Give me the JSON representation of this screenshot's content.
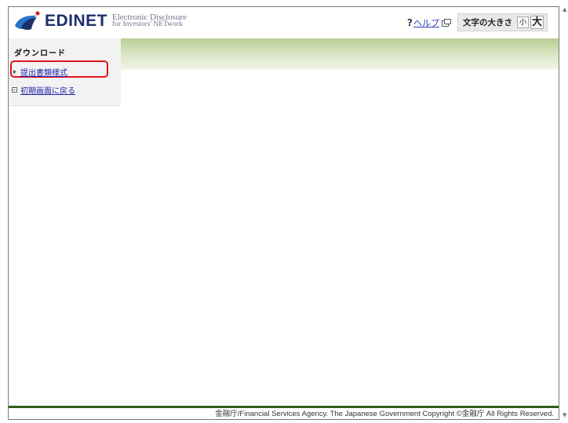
{
  "header": {
    "logo_word": "EDINET",
    "logo_sub_line1": "Electronic Disclosure",
    "logo_sub_line2": "for Investors' NETwork",
    "help_question": "?",
    "help_label": "ヘルプ",
    "font_size_label": "文字の大きさ",
    "font_small_label": "小",
    "font_large_label": "大"
  },
  "sidebar": {
    "title": "ダウンロード",
    "items": [
      {
        "label": "提出書類様式",
        "highlighted": true
      },
      {
        "label": "初期画面に戻る",
        "highlighted": false
      }
    ]
  },
  "footer": {
    "copyright": "金融庁/Financial Services Agency. The Japanese Government Copyright ©金融庁 All Rights Reserved."
  },
  "colors": {
    "brand_navy": "#1f2f6a",
    "brand_blue": "#2a73c8",
    "link": "#2525a8",
    "highlight_border": "#e3141b",
    "band_green": "#b9ce94",
    "footer_green": "#2e5e16"
  },
  "icons": {
    "logo": "edinet-logo-icon",
    "external_link": "external-link-icon",
    "bullet_arrow": "arrow-bullet-icon",
    "bullet_square": "square-bullet-icon"
  }
}
